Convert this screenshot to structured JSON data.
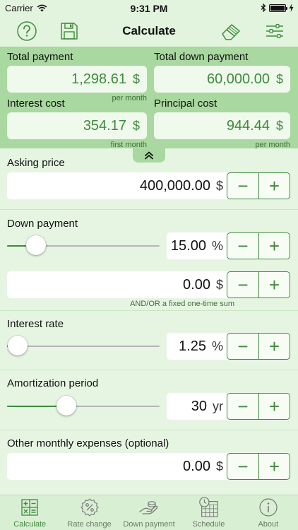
{
  "status": {
    "carrier": "Carrier",
    "time": "9:31 PM"
  },
  "header": {
    "title": "Calculate",
    "help_icon": "question-circle-icon",
    "save_icon": "floppy-disk-icon",
    "clear_icon": "eraser-icon",
    "settings_icon": "sliders-icon"
  },
  "summary": {
    "total_payment": {
      "label": "Total payment",
      "value": "1,298.61",
      "unit": "$",
      "caption": "per month"
    },
    "total_down_payment": {
      "label": "Total down payment",
      "value": "60,000.00",
      "unit": "$",
      "caption": ""
    },
    "interest_cost": {
      "label": "Interest cost",
      "value": "354.17",
      "unit": "$",
      "caption": "first month"
    },
    "principal_cost": {
      "label": "Principal cost",
      "value": "944.44",
      "unit": "$",
      "caption": "per month"
    }
  },
  "asking_price": {
    "label": "Asking price",
    "value": "400,000.00",
    "unit": "$"
  },
  "down_payment": {
    "label": "Down payment",
    "percent_value": "15.00",
    "percent_unit": "%",
    "slider_fraction": 0.19,
    "sum_value": "0.00",
    "sum_unit": "$",
    "sum_caption": "AND/OR a fixed one-time sum"
  },
  "interest_rate": {
    "label": "Interest rate",
    "value": "1.25",
    "unit": "%",
    "slider_fraction": 0.07
  },
  "amortization": {
    "label": "Amortization period",
    "value": "30",
    "unit": "yr",
    "slider_fraction": 0.39
  },
  "other_expenses": {
    "label": "Other monthly expenses (optional)",
    "value": "0.00",
    "unit": "$"
  },
  "stepper": {
    "minus": "−",
    "plus": "+"
  },
  "colors": {
    "accent": "#3f8a3c",
    "summary_bg": "#a9d8a0",
    "page_bg": "#e6f5e2"
  },
  "tabs": [
    {
      "label": "Calculate",
      "icon": "calculator-icon",
      "active": true
    },
    {
      "label": "Rate change",
      "icon": "percent-badge-icon",
      "active": false
    },
    {
      "label": "Down payment",
      "icon": "hand-coin-icon",
      "active": false
    },
    {
      "label": "Schedule",
      "icon": "calendar-clock-icon",
      "active": false
    },
    {
      "label": "About",
      "icon": "info-circle-icon",
      "active": false
    }
  ]
}
